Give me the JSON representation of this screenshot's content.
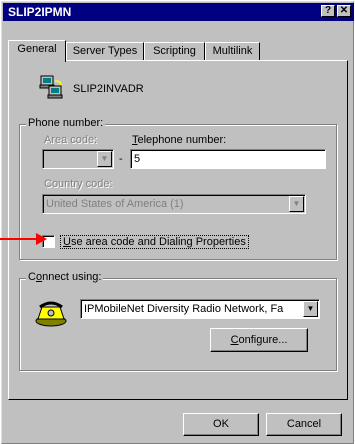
{
  "window": {
    "title": "SLIP2IPMN",
    "help_button": "?",
    "close_button": "✕"
  },
  "tabs": [
    "General",
    "Server Types",
    "Scripting",
    "Multilink"
  ],
  "connection": {
    "name": "SLIP2INVADR"
  },
  "phone_group": {
    "label": "Phone number:",
    "area_code_label": "Area code:",
    "area_code_value": "",
    "dash": "-",
    "telephone_label": "Telephone number:",
    "telephone_value": "5",
    "country_label": "Country code:",
    "country_value": "United States of America (1)",
    "checkbox_label": "Use area code and Dialing Properties",
    "checkbox_checked": false
  },
  "connect_group": {
    "label": "Connect using:",
    "device_value": "IPMobileNet Diversity Radio Network, Fa",
    "configure_button": "Configure..."
  },
  "buttons": {
    "ok": "OK",
    "cancel": "Cancel"
  },
  "colors": {
    "annotation_arrow": "#ff0000",
    "titlebar": "#000080"
  }
}
